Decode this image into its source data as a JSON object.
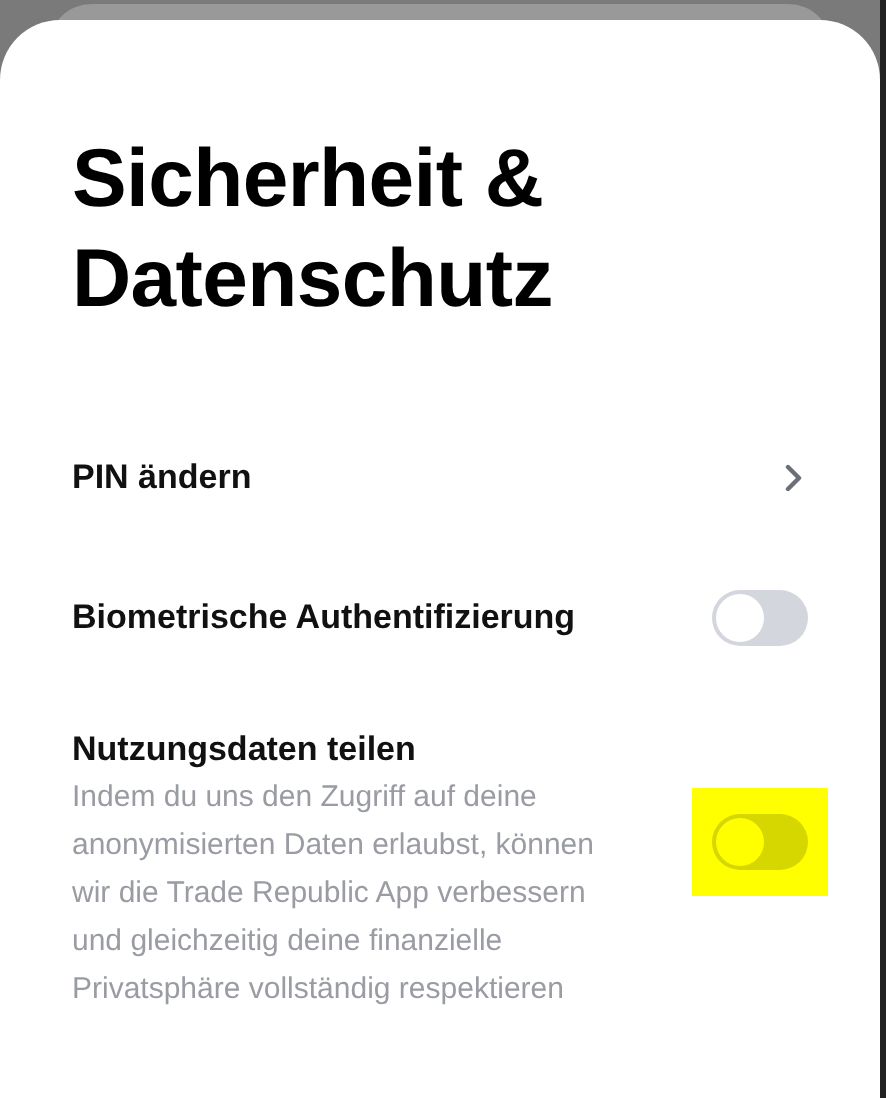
{
  "title": "Sicherheit & Datenschutz",
  "items": [
    {
      "kind": "link",
      "label": "PIN ändern"
    },
    {
      "kind": "toggle",
      "label": "Biometrische Authentifizierung",
      "on": false,
      "highlighted": false
    },
    {
      "kind": "toggle",
      "label": "Nutzungsdaten teilen",
      "description": "Indem du uns den Zugriff auf deine anonymisierten Daten erlaubst, können wir die Trade Republic App verbessern und gleichzeitig deine finanzielle Privatsphäre vollständig respektieren",
      "on": false,
      "highlighted": true
    }
  ]
}
